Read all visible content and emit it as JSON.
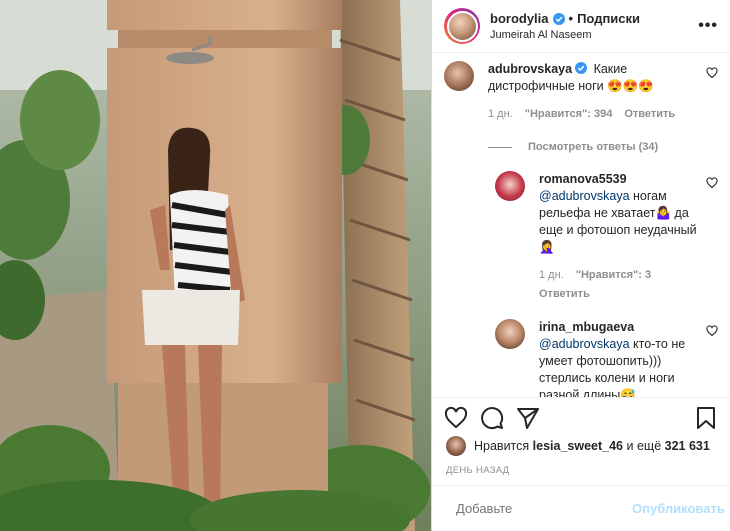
{
  "post": {
    "username": "borodylia",
    "follow_label": "Подписки",
    "location": "Jumeirah Al Naseem"
  },
  "comments": [
    {
      "username": "adubrovskaya",
      "text": "Какие дистрофичные ноги 😍😍😍",
      "time": "1 дн.",
      "likes": "\"Нравится\": 394",
      "reply_label": "Ответить"
    }
  ],
  "view_replies": "Посмотреть ответы (34)",
  "replies": [
    {
      "username": "romanova5539",
      "mention": "@adubrovskaya",
      "text": "ногам рельефа не хватает🤷‍♀️ да еще и фотошоп неудачный🤦‍♀️",
      "time": "1 дн.",
      "likes": "\"Нравится\": 3",
      "reply_label": "Ответить"
    },
    {
      "username": "irina_mbugaeva",
      "mention": "@adubrovskaya",
      "text": "кто-то не умеет фотошопить))) стерлись колени и ноги разной длины😅"
    }
  ],
  "likes": {
    "prefix": "Нравится",
    "user": "lesia_sweet_46",
    "middle": "и ещё",
    "count": "321 631"
  },
  "timestamp": "ДЕНЬ НАЗАД",
  "add_comment": {
    "placeholder": "Добавьте",
    "publish_label": "Опубликовать"
  },
  "colors": {
    "verified": "#3897f0",
    "link": "#00376b",
    "muted": "#8e8e8e",
    "publish_disabled": "#b2dffc"
  }
}
